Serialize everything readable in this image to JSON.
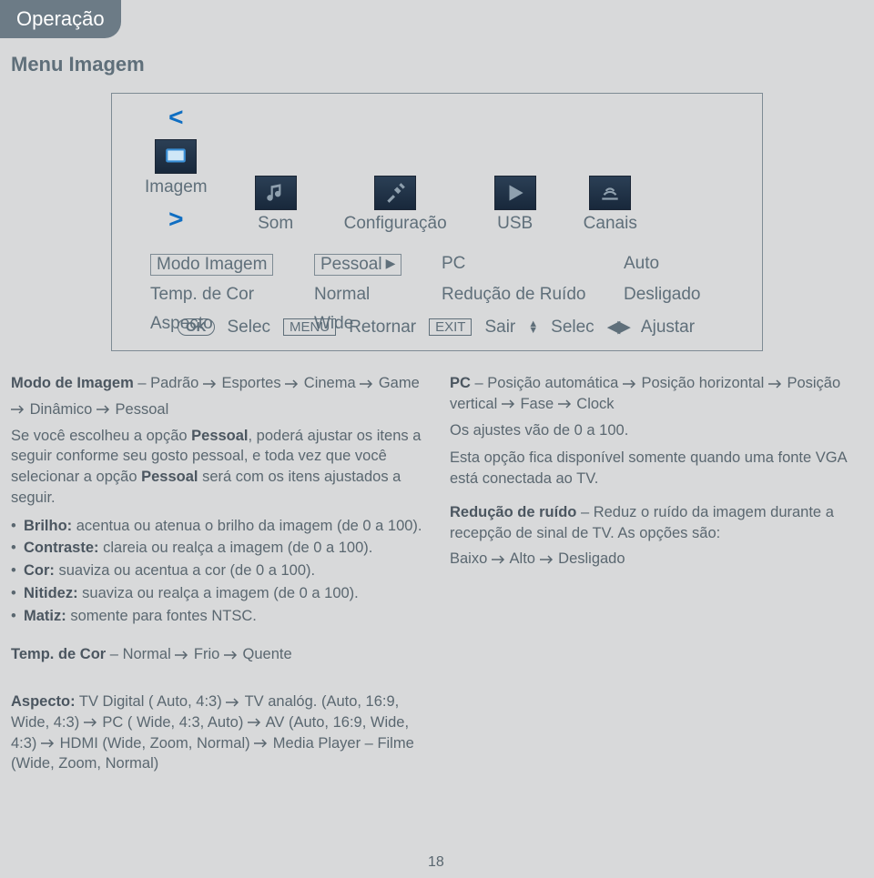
{
  "header": {
    "tab": "Operação",
    "section": "Menu Imagem"
  },
  "nav": {
    "imagem": "Imagem",
    "som": "Som",
    "config": "Configuração",
    "usb": "USB",
    "canais": "Canais"
  },
  "settings": {
    "r1c1": "Modo Imagem",
    "r1c2": "Pessoal",
    "r1c3": "PC",
    "r1c4": "Auto",
    "r2c1": "Temp. de Cor",
    "r2c2": "Normal",
    "r2c3": "Redução de Ruído",
    "r2c4": "Desligado",
    "r3c1": "Aspecto",
    "r3c2": "Wide"
  },
  "footer": {
    "ok": "OK",
    "selec": "Selec",
    "menu": "MENU",
    "retornar": "Retornar",
    "exit": "EXIT",
    "sair": "Sair",
    "selec2": "Selec",
    "ajustar": "Ajustar"
  },
  "left": {
    "l1a": "Modo de Imagem",
    "l1b": " – Padrão ",
    "l1c": " Esportes ",
    "l1d": " Cinema ",
    "l1e": " Game",
    "l2a": " Dinâmico ",
    "l2b": " Pessoal",
    "l3": "Se você escolheu a opção ",
    "l3b": "Pessoal",
    "l3c": ", poderá ajustar os itens a seguir conforme seu gosto pessoal, e toda vez que você selecionar a opção ",
    "l3d": "Pessoal",
    "l3e": " será com os itens ajustados a seguir.",
    "b1a": "Brilho:",
    "b1b": " acentua ou atenua o brilho da imagem (de 0 a 100).",
    "b2a": "Contraste:",
    "b2b": " clareia ou realça a imagem (de 0 a 100).",
    "b3a": "Cor:",
    "b3b": " suaviza ou acentua a cor (de 0 a 100).",
    "b4a": "Nitidez:",
    "b4b": " suaviza ou realça a imagem (de 0 a 100).",
    "b5a": "Matiz:",
    "b5b": " somente para fontes NTSC."
  },
  "right": {
    "r1a": "PC",
    "r1b": " – Posição automática ",
    "r1c": " Posição horizontal ",
    "r1d": " Posição vertical ",
    "r1e": " Fase ",
    "r1f": " Clock",
    "r2": "Os ajustes vão de 0 a 100.",
    "r3": "Esta opção fica disponível somente quando uma fonte VGA está conectada ao TV.",
    "r4a": "Redução de ruído",
    "r4b": " – Reduz o ruído da imagem durante a recepção de sinal de TV. As opções são:",
    "r5a": "Baixo ",
    "r5b": " Alto ",
    "r5c": " Desligado"
  },
  "temp": {
    "a": "Temp. de Cor",
    "b": " – Normal ",
    "c": " Frio ",
    "d": " Quente"
  },
  "aspecto": {
    "a": "Aspecto:",
    "b": " TV Digital ( Auto, 4:3) ",
    "c": " TV analóg. (Auto, 16:9, Wide, 4:3) ",
    "d": " PC ( Wide, 4:3, Auto) ",
    "e": " AV (Auto, 16:9, Wide, 4:3) ",
    "f": " HDMI (Wide, Zoom, Normal) ",
    "g": " Media Player – Filme (Wide, Zoom, Normal)"
  },
  "page": "18"
}
